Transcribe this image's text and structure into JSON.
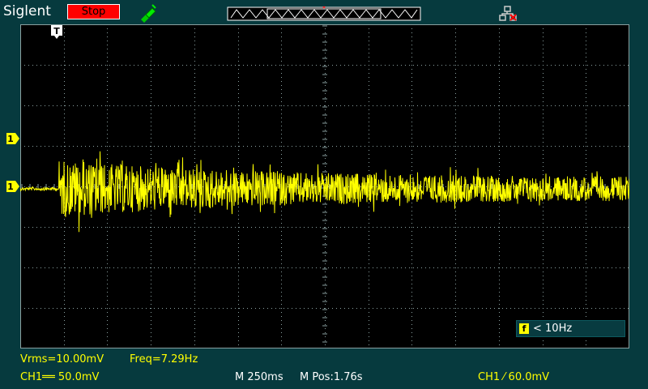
{
  "header": {
    "brand": "Siglent",
    "run_state": "Stop",
    "run_state_color": "#ff0000",
    "trigger_marker_label": "T"
  },
  "colors": {
    "background": "#063a3e",
    "grid": "#8aa0a0",
    "trace": "#ffff00",
    "text_status": "#ffffff"
  },
  "channel_markers": {
    "trigger_level_label": "1",
    "ch1_ground_label": "1"
  },
  "freq_box": {
    "badge": "f",
    "text": "< 10Hz"
  },
  "measurements": {
    "vrms": "Vrms=10.00mV",
    "freq": "Freq=7.29Hz"
  },
  "status_bar": {
    "ch1_scale": "CH1══ 50.0mV",
    "timebase": "M 250ms",
    "mpos": "M Pos:1.76s",
    "trigger": "CH1 ⁄ 60.0mV"
  },
  "icons": {
    "probe": "probe-pen-icon",
    "network": "network-icon",
    "trigger_position": "trigger-position-icon"
  }
}
